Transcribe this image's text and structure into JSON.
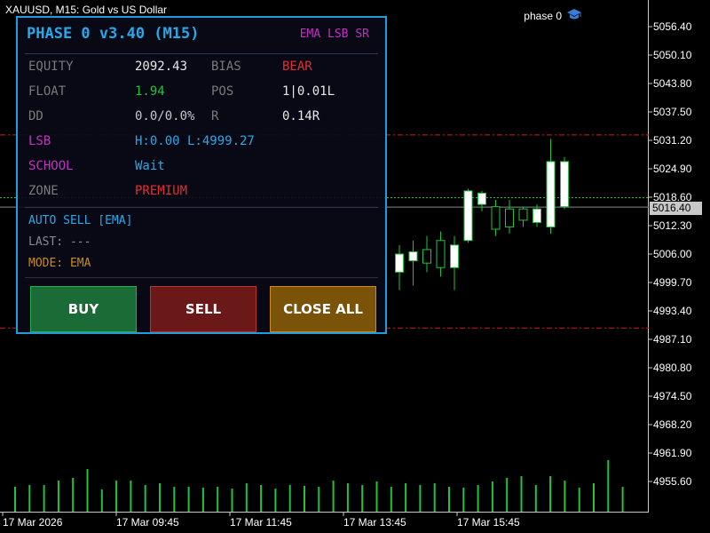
{
  "chart": {
    "title": "XAUUSD, M15:  Gold vs US Dollar",
    "ea_name": "phase 0",
    "current_price": "5016.40",
    "price_ticks": [
      "5056.40",
      "5050.10",
      "5043.80",
      "5037.50",
      "5031.20",
      "5024.90",
      "5018.60",
      "5012.30",
      "5006.00",
      "4999.70",
      "4993.40",
      "4987.10",
      "4980.80",
      "4974.50",
      "4968.20",
      "4961.90",
      "4955.60"
    ],
    "time_ticks": [
      "17 Mar 2026",
      "17 Mar 09:45",
      "17 Mar 11:45",
      "17 Mar 13:45",
      "17 Mar 15:45"
    ],
    "level_lines": [
      "5032.40",
      "4989.60"
    ],
    "candles": [
      {
        "o": 5002.0,
        "h": 5008.0,
        "l": 4998.0,
        "c": 5006.0
      },
      {
        "o": 5004.5,
        "h": 5009.0,
        "l": 4999.0,
        "c": 5006.5
      },
      {
        "o": 5007.0,
        "h": 5010.0,
        "l": 5002.0,
        "c": 5004.0
      },
      {
        "o": 5009.0,
        "h": 5011.0,
        "l": 5001.0,
        "c": 5003.0
      },
      {
        "o": 5003.0,
        "h": 5010.0,
        "l": 4998.0,
        "c": 5008.0
      },
      {
        "o": 5009.0,
        "h": 5020.5,
        "l": 5008.5,
        "c": 5020.0
      },
      {
        "o": 5017.0,
        "h": 5020.0,
        "l": 5015.5,
        "c": 5019.5
      },
      {
        "o": 5016.5,
        "h": 5018.0,
        "l": 5010.0,
        "c": 5011.5
      },
      {
        "o": 5016.0,
        "h": 5018.0,
        "l": 5010.5,
        "c": 5012.0
      },
      {
        "o": 5016.0,
        "h": 5016.5,
        "l": 5012.0,
        "c": 5013.5
      },
      {
        "o": 5013.0,
        "h": 5017.0,
        "l": 5012.0,
        "c": 5016.0
      },
      {
        "o": 5012.0,
        "h": 5031.5,
        "l": 5010.5,
        "c": 5026.5
      },
      {
        "o": 5016.5,
        "h": 5027.5,
        "l": 5016.0,
        "c": 5026.5
      }
    ],
    "volumes": [
      28,
      30,
      30,
      35,
      38,
      48,
      25,
      35,
      35,
      30,
      32,
      28,
      28,
      27,
      28,
      26,
      32,
      30,
      26,
      30,
      29,
      28,
      35,
      32,
      30,
      34,
      28,
      32,
      30,
      32,
      28,
      27,
      30,
      34,
      38,
      40,
      30,
      40,
      35,
      27,
      32,
      58,
      28
    ]
  },
  "panel": {
    "title": "PHASE 0 v3.40 (M15)",
    "tags": "EMA LSB SR",
    "equity_label": "EQUITY",
    "equity_value": "2092.43",
    "bias_label": "BIAS",
    "bias_value": "BEAR",
    "float_label": "FLOAT",
    "float_value": "1.94",
    "pos_label": "POS",
    "pos_value": "1|0.01L",
    "dd_label": "DD",
    "dd_value": "0.0/0.0%",
    "r_label": "R",
    "r_value": "0.14R",
    "lsb_label": "LSB",
    "lsb_value": "H:0.00 L:4999.27",
    "school_label": "SCHOOL",
    "school_value": "Wait",
    "zone_label": "ZONE",
    "zone_value": "PREMIUM",
    "auto_text": "AUTO SELL [EMA]",
    "last_text": "LAST: ---",
    "mode_text": "MODE: EMA",
    "buy_label": "BUY",
    "sell_label": "SELL",
    "close_all_label": "CLOSE ALL"
  },
  "colors": {
    "accent": "#29a8e8",
    "bull": "#21c33a",
    "bear_text": "#e03030",
    "magenta": "#c033c0",
    "orange": "#d08a10"
  }
}
